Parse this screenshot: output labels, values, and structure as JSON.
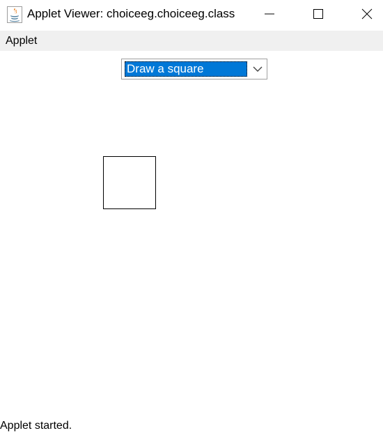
{
  "window": {
    "title": "Applet Viewer: choiceeg.choiceeg.class",
    "icon": "java-icon",
    "controls": [
      "minimize-icon",
      "maximize-icon",
      "close-icon"
    ]
  },
  "menu": {
    "items": [
      {
        "label": "Applet"
      }
    ]
  },
  "applet": {
    "choice": {
      "selected": "Draw a square",
      "icon": "chevron-down-icon",
      "highlight_color": "#0078d7"
    },
    "drawn_shape": "square"
  },
  "status": {
    "text": "Applet started."
  }
}
